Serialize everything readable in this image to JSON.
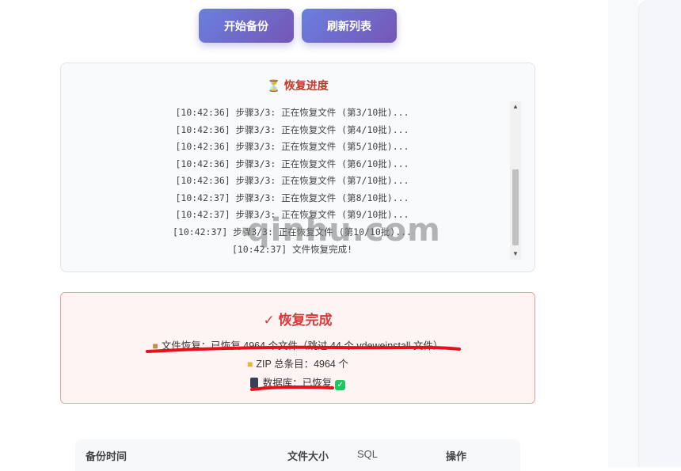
{
  "toolbar": {
    "backup_label": "开始备份",
    "refresh_label": "刷新列表"
  },
  "progress": {
    "title": "恢复进度",
    "hourglass_icon": "hourglass-icon",
    "log": [
      "[10:42:36] 步骤3/3: 正在恢复文件 (第3/10批)...",
      "[10:42:36] 步骤3/3: 正在恢复文件 (第4/10批)...",
      "[10:42:36] 步骤3/3: 正在恢复文件 (第5/10批)...",
      "[10:42:36] 步骤3/3: 正在恢复文件 (第6/10批)...",
      "[10:42:36] 步骤3/3: 正在恢复文件 (第7/10批)...",
      "[10:42:37] 步骤3/3: 正在恢复文件 (第8/10批)...",
      "[10:42:37] 步骤3/3: 正在恢复文件 (第9/10批)...",
      "[10:42:37] 步骤3/3: 正在恢复文件 (第10/10批)...",
      "[10:42:37] 文件恢复完成!"
    ]
  },
  "watermark": "qinhu.com",
  "result": {
    "title": "✓ 恢复完成",
    "files_line": "文件恢复：已恢复 4964 个文件（跳过 44 个 vdeweinstall 文件）",
    "zip_line": "ZIP 总条目：4964 个",
    "db_line": "数据库：已恢复",
    "colors": {
      "accent": "#d63a3a",
      "annotation": "#e8101a",
      "success": "#22c55e"
    }
  },
  "table": {
    "headers": [
      "备份时间",
      "文件大小",
      "SQL",
      "操作"
    ]
  },
  "theme": {
    "button_gradient": [
      "#6a7fe0",
      "#7557b4"
    ]
  }
}
